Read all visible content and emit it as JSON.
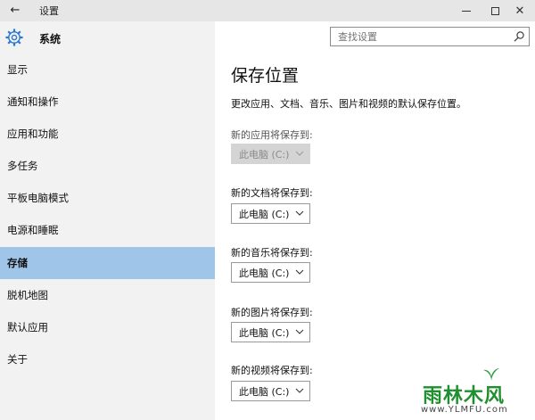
{
  "window": {
    "title": "设置",
    "back_icon": "back-arrow-icon"
  },
  "header": {
    "section_title": "系统",
    "section_icon": "gear-icon"
  },
  "search": {
    "placeholder": "查找设置",
    "value": "",
    "icon": "search-icon"
  },
  "sidebar": {
    "items": [
      {
        "label": "显示"
      },
      {
        "label": "通知和操作"
      },
      {
        "label": "应用和功能"
      },
      {
        "label": "多任务"
      },
      {
        "label": "平板电脑模式"
      },
      {
        "label": "电源和睡眠"
      },
      {
        "label": "存储",
        "active": true
      },
      {
        "label": "脱机地图"
      },
      {
        "label": "默认应用"
      },
      {
        "label": "关于"
      }
    ]
  },
  "main": {
    "title": "保存位置",
    "description": "更改应用、文档、音乐、图片和视频的默认保存位置。",
    "fields": [
      {
        "label": "新的应用将保存到:",
        "value": "此电脑 (C:)",
        "disabled": true
      },
      {
        "label": "新的文档将保存到:",
        "value": "此电脑 (C:)",
        "disabled": false
      },
      {
        "label": "新的音乐将保存到:",
        "value": "此电脑 (C:)",
        "disabled": false
      },
      {
        "label": "新的图片将保存到:",
        "value": "此电脑 (C:)",
        "disabled": false
      },
      {
        "label": "新的视频将保存到:",
        "value": "此电脑 (C:)",
        "disabled": false
      }
    ]
  },
  "watermark": {
    "brand": "雨林木风",
    "url": "www.YLMFU.com"
  },
  "colors": {
    "titlebar": "#e6e6e6",
    "sidebar": "#f2f2f2",
    "active_item": "#9fc5e8",
    "accent": "#2b79d0"
  }
}
